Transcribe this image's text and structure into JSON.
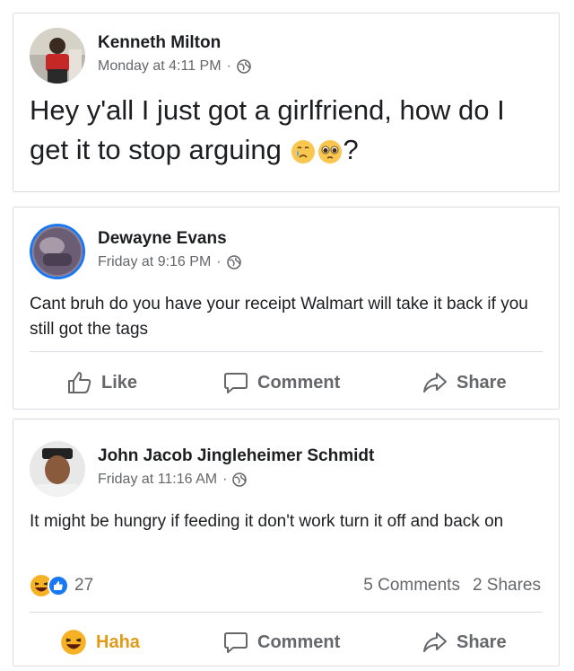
{
  "posts": [
    {
      "author": "Kenneth Milton",
      "time": "Monday at 4:11 PM",
      "separator": "·",
      "text_before_emoji": "Hey y'all I just got a girlfriend, how do I get it to stop arguing",
      "text_after_emoji": "?",
      "privacy_icon": "globe-icon",
      "emojis": [
        "crying-face-icon",
        "pleading-face-icon"
      ]
    },
    {
      "author": "Dewayne Evans",
      "time": "Friday at 9:16 PM",
      "separator": "·",
      "text": "Cant bruh do you have your receipt Walmart will take it back if you still got the tags",
      "privacy_icon": "globe-icon",
      "actions": {
        "like": "Like",
        "comment": "Comment",
        "share": "Share"
      }
    },
    {
      "author": "John Jacob Jingleheimer Schmidt",
      "time": "Friday at 11:16 AM",
      "separator": "·",
      "text": "It might be hungry if feeding it don't work turn it off and back on",
      "privacy_icon": "globe-icon",
      "reaction_count": "27",
      "comments_count": "5 Comments",
      "shares_count": "2 Shares",
      "actions": {
        "haha": "Haha",
        "comment": "Comment",
        "share": "Share"
      }
    }
  ],
  "colors": {
    "text": "#1c1e21",
    "secondary": "#65676b",
    "haha_orange": "#f7b125",
    "like_blue": "#1877f2",
    "border": "#dadde1"
  }
}
